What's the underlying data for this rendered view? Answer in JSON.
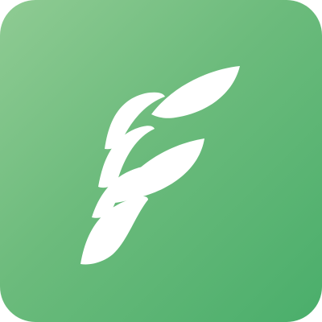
{
  "app_icon": {
    "name": "leaf-f-app-icon",
    "gradient": [
      "#8fcb93",
      "#6cbb7c",
      "#4aae6b"
    ],
    "glyph_color": "#ffffff",
    "glyph_icon": "leaf-f-logo-icon"
  }
}
